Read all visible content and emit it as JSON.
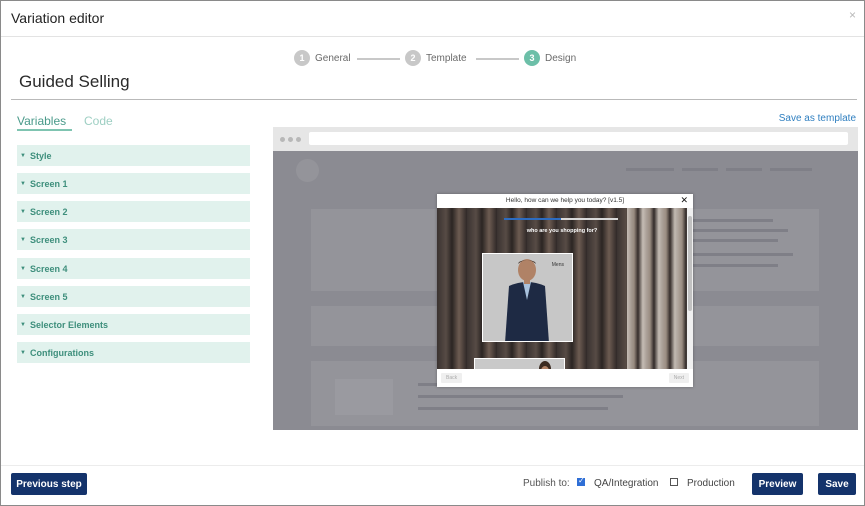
{
  "window": {
    "title": "Variation editor",
    "close_icon": "×"
  },
  "stepper": {
    "steps": [
      {
        "num": "1",
        "label": "General",
        "active": false
      },
      {
        "num": "2",
        "label": "Template",
        "active": false
      },
      {
        "num": "3",
        "label": "Design",
        "active": true
      }
    ]
  },
  "page_title": "Guided Selling",
  "tabs": {
    "variables": "Variables",
    "code": "Code",
    "active": "variables"
  },
  "save_as_template": "Save as template",
  "sections": [
    "Style",
    "Screen 1",
    "Screen 2",
    "Screen 3",
    "Screen 4",
    "Screen 5",
    "Selector Elements",
    "Configurations"
  ],
  "preview": {
    "popup_header": "Hello, how can we help you today? [v1.5]",
    "question": "who are you shopping for?",
    "card_label": "Mens",
    "progress": 0.5,
    "back_label": "Back",
    "next_label": "Next"
  },
  "footer": {
    "previous_step": "Previous step",
    "publish_to": "Publish to:",
    "qa_label": "QA/Integration",
    "qa_checked": true,
    "production_label": "Production",
    "production_checked": false,
    "preview": "Preview",
    "save": "Save"
  },
  "colors": {
    "accent": "#6cbfa8",
    "primary_button": "#14336b",
    "link": "#2f7fc0",
    "section_bg": "#e1f2ed"
  }
}
